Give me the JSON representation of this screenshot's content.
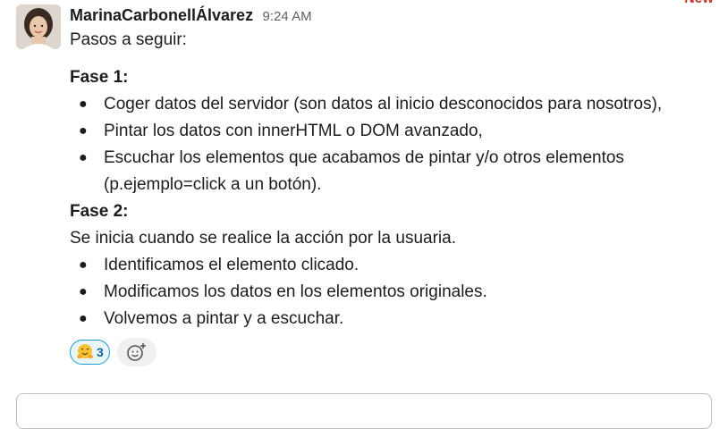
{
  "badge": {
    "new_label": "New"
  },
  "message": {
    "author": "MarinaCarbonellÁlvarez",
    "time": "9:24 AM",
    "intro": "Pasos a seguir:",
    "phase1_title": "Fase 1:",
    "phase1_items": [
      "Coger datos del servidor (son datos al inicio desconocidos para nosotros),",
      "Pintar los datos con innerHTML o DOM avanzado,",
      "Escuchar los elementos que acabamos de pintar y/o otros elementos",
      "(p.ejemplo=click a un botón)."
    ],
    "phase2_title": "Fase 2:",
    "phase2_intro": "Se inicia cuando se realice la acción por la usuaria.",
    "phase2_items": [
      "Identificamos el elemento clicado.",
      "Modificamos los datos en los elementos originales.",
      "Volvemos a pintar y a escuchar."
    ],
    "bullet_char": "●"
  },
  "reactions": [
    {
      "emoji": "hugging-face",
      "count": "3"
    }
  ],
  "icons": {
    "add_reaction": "add-reaction-icon"
  },
  "colors": {
    "reaction_border": "#1d9bd1",
    "reaction_bg": "#e8f5fa",
    "reaction_count": "#1264a3",
    "new_badge": "#c0392b"
  }
}
